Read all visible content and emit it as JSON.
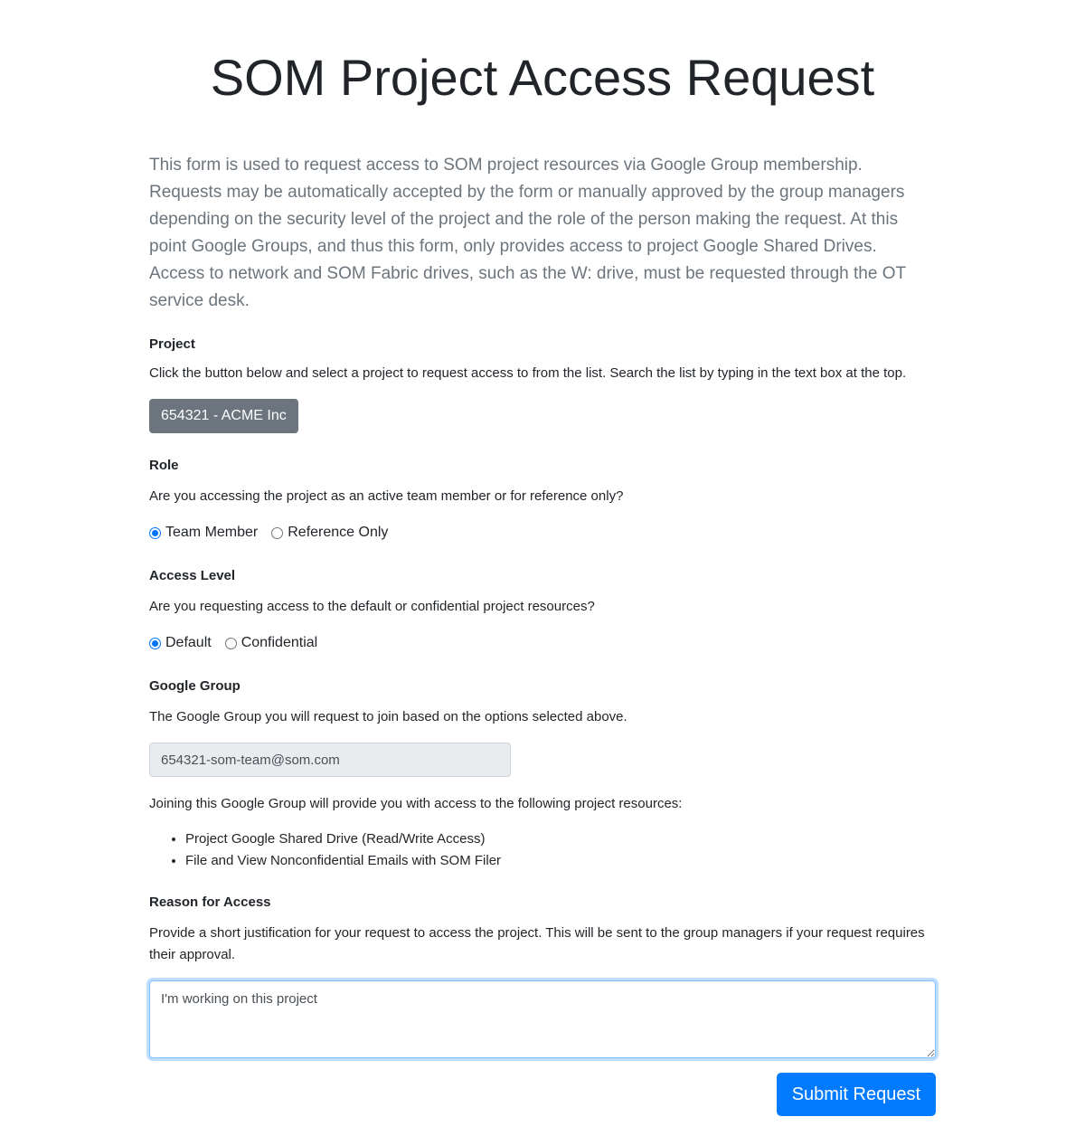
{
  "page": {
    "title": "SOM Project Access Request",
    "intro": "This form is used to request access to SOM project resources via Google Group membership. Requests may be automatically accepted by the form or manually approved by the group managers depending on the security level of the project and the role of the person making the request. At this point Google Groups, and thus this form, only provides access to project Google Shared Drives. Access to network and SOM Fabric drives, such as the W: drive, must be requested through the OT service desk."
  },
  "project": {
    "heading": "Project",
    "description": "Click the button below and select a project to request access to from the list. Search the list by typing in the text box at the top.",
    "selected_label": "654321 - ACME Inc"
  },
  "role": {
    "heading": "Role",
    "description": "Are you accessing the project as an active team member or for reference only?",
    "options": [
      {
        "label": "Team Member",
        "checked": true
      },
      {
        "label": "Reference Only",
        "checked": false
      }
    ]
  },
  "access_level": {
    "heading": "Access Level",
    "description": "Are you requesting access to the default or confidential project resources?",
    "options": [
      {
        "label": "Default",
        "checked": true
      },
      {
        "label": "Confidential",
        "checked": false
      }
    ]
  },
  "google_group": {
    "heading": "Google Group",
    "description": "The Google Group you will request to join based on the options selected above.",
    "value": "654321-som-team@som.com",
    "resources_intro": "Joining this Google Group will provide you with access to the following project resources:",
    "resources": [
      "Project Google Shared Drive (Read/Write Access)",
      "File and View Nonconfidential Emails with SOM Filer"
    ]
  },
  "reason": {
    "heading": "Reason for Access",
    "description": "Provide a short justification for your request to access the project. This will be sent to the group managers if your request requires their approval.",
    "value": "I'm working on this project"
  },
  "submit": {
    "label": "Submit Request"
  },
  "colors": {
    "primary": "#007bff",
    "secondary": "#6c757d",
    "radio_checked": "#0075ff"
  }
}
